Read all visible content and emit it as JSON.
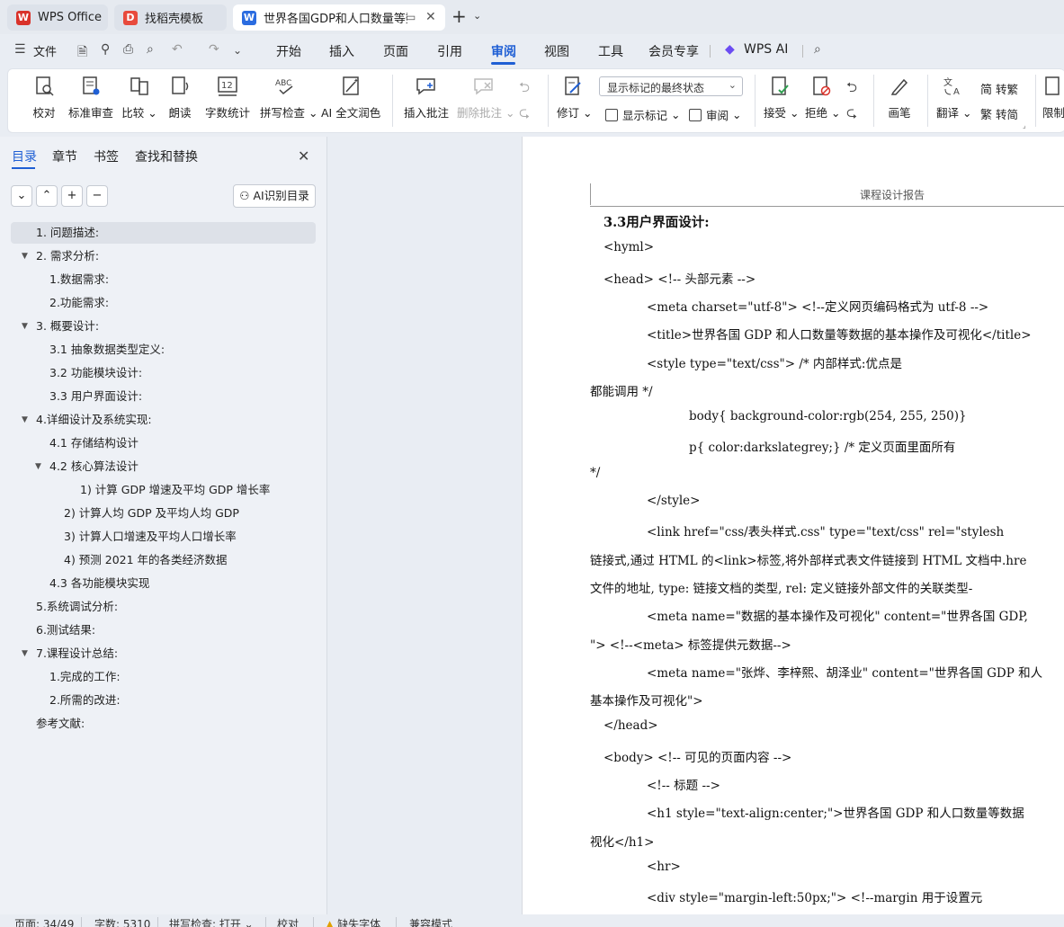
{
  "tabs": [
    {
      "label": "WPS Office",
      "icon": "wps-logo-icon"
    },
    {
      "label": "找稻壳模板",
      "icon": "docer-icon"
    },
    {
      "label": "世界各国GDP和人口数量等数",
      "icon": "word-doc-icon",
      "active": true
    }
  ],
  "tab_icon_glyphs": {
    "wps": "W",
    "docer": "D",
    "doc": "W"
  },
  "menu": {
    "file_label": "文件",
    "items": [
      "开始",
      "插入",
      "页面",
      "引用",
      "审阅",
      "视图",
      "工具",
      "会员专享"
    ],
    "active": "审阅",
    "ai_label": "WPS AI"
  },
  "ribbon": {
    "proofread": "校对",
    "standard_review": "标准审查",
    "compare": "比较",
    "read_aloud": "朗读",
    "word_count": "字数统计",
    "spell_check": "拼写检查",
    "ai_polish": "AI 全文润色",
    "insert_comment": "插入批注",
    "delete_comment": "删除批注",
    "track_changes": "修订",
    "markup_mode": "显示标记的最终状态",
    "show_markup": "显示标记",
    "review": "审阅",
    "accept": "接受",
    "reject": "拒绝",
    "ink": "画笔",
    "translate": "翻译",
    "to_traditional": "转繁",
    "to_simplified": "转简",
    "restrict": "限制",
    "icon_text": {
      "word_count": "12",
      "spell": "ABC"
    }
  },
  "nav": {
    "tabs": [
      "目录",
      "章节",
      "书签",
      "查找和替换"
    ],
    "active_tab": "目录",
    "ai_toc_button": "AI识别目录",
    "toc": [
      {
        "text": "1. 问题描述:",
        "level": 1,
        "expand": "",
        "selected": true
      },
      {
        "text": "2. 需求分析:",
        "level": 1,
        "expand": "▼"
      },
      {
        "text": "1.数据需求:",
        "level": 2,
        "expand": ""
      },
      {
        "text": "2.功能需求:",
        "level": 2,
        "expand": ""
      },
      {
        "text": "3. 概要设计:",
        "level": 1,
        "expand": "▼"
      },
      {
        "text": "3.1 抽象数据类型定义:",
        "level": 2,
        "expand": ""
      },
      {
        "text": "3.2 功能模块设计:",
        "level": 2,
        "expand": ""
      },
      {
        "text": "3.3 用户界面设计:",
        "level": 2,
        "expand": ""
      },
      {
        "text": "4.详细设计及系统实现:",
        "level": 1,
        "expand": "▼"
      },
      {
        "text": "4.1 存储结构设计",
        "level": 2,
        "expand": ""
      },
      {
        "text": "4.2 核心算法设计",
        "level": 2,
        "expand": "▼"
      },
      {
        "text": "1) 计算 GDP 增速及平均 GDP 增长率",
        "level": 4,
        "expand": ""
      },
      {
        "text": "2) 计算人均 GDP 及平均人均 GDP",
        "level": 3,
        "expand": ""
      },
      {
        "text": "3) 计算人口增速及平均人口增长率",
        "level": 3,
        "expand": ""
      },
      {
        "text": "4) 预测 2021 年的各类经济数据",
        "level": 3,
        "expand": ""
      },
      {
        "text": "4.3 各功能模块实现",
        "level": 2,
        "expand": ""
      },
      {
        "text": "5.系统调试分析:",
        "level": 1,
        "expand": ""
      },
      {
        "text": "6.测试结果:",
        "level": 1,
        "expand": ""
      },
      {
        "text": "7.课程设计总结:",
        "level": 1,
        "expand": "▼"
      },
      {
        "text": "1.完成的工作:",
        "level": 2,
        "expand": ""
      },
      {
        "text": "2.所需的改进:",
        "level": 2,
        "expand": ""
      },
      {
        "text": "参考文献:",
        "level": 1,
        "expand": ""
      }
    ]
  },
  "document": {
    "header": "课程设计报告",
    "lines": [
      {
        "text": "3.3用户界面设计:",
        "indent": 0,
        "heading": true
      },
      {
        "text": "<hyml>",
        "indent": 0
      },
      {
        "text": "<head>   <!-- 头部元素 -->",
        "indent": 0
      },
      {
        "text": "<meta charset=\"utf-8\">    <!--定义网页编码格式为 utf-8 -->",
        "indent": 1
      },
      {
        "text": "<title>世界各国 GDP 和人口数量等数据的基本操作及可视化</title>",
        "indent": 1
      },
      {
        "text": "<style type=\"text/css\">                    /* 内部样式:优点是",
        "indent": 1
      },
      {
        "text": "都能调用   */",
        "indent": -1
      },
      {
        "text": "body{ background-color:rgb(254, 255, 250)}",
        "indent": 2
      },
      {
        "text": "p{ color:darkslategrey;}          /* 定义页面里面所有",
        "indent": 2
      },
      {
        "text": "*/",
        "indent": -1
      },
      {
        "text": "</style>",
        "indent": 1
      },
      {
        "text": "<link href=\"css/表头样式.css\" type=\"text/css\" rel=\"stylesh",
        "indent": 1
      },
      {
        "text": "链接式,通过 HTML 的<link>标签,将外部样式表文件链接到 HTML 文档中.hre",
        "indent": -1
      },
      {
        "text": "文件的地址, type: 链接文档的类型, rel: 定义链接外部文件的关联类型-",
        "indent": -1
      },
      {
        "text": "<meta name=\"数据的基本操作及可视化\" content=\"世界各国 GDP,",
        "indent": 1
      },
      {
        "text": "\">   <!--<meta> 标签提供元数据-->",
        "indent": -1
      },
      {
        "text": "<meta name=\"张烨、李梓熙、胡泽业\" content=\"世界各国 GDP 和人",
        "indent": 1
      },
      {
        "text": "基本操作及可视化\">",
        "indent": -1
      },
      {
        "text": "</head>",
        "indent": 0
      },
      {
        "text": "<body>    <!-- 可见的页面内容 -->",
        "indent": 0
      },
      {
        "text": "<!-- 标题 -->",
        "indent": 1
      },
      {
        "text": "<h1 style=\"text-align:center;\">世界各国 GDP 和人口数量等数据",
        "indent": 1
      },
      {
        "text": "视化</h1>",
        "indent": -1
      },
      {
        "text": "<hr>",
        "indent": 1
      },
      {
        "text": "<div style=\"margin-left:50px;\">       <!--margin 用于设置元",
        "indent": 1
      }
    ]
  },
  "status": {
    "page": "页面: 34/49",
    "words": "字数: 5310",
    "spell": "拼写检查: 打开",
    "proof": "校对",
    "missing_font": "缺失字体",
    "compat": "兼容模式"
  },
  "colors": {
    "accent": "#1f5fd4",
    "wps_red": "#d9322a",
    "docer_red": "#e84a3c",
    "word_blue": "#2b6ce0"
  }
}
